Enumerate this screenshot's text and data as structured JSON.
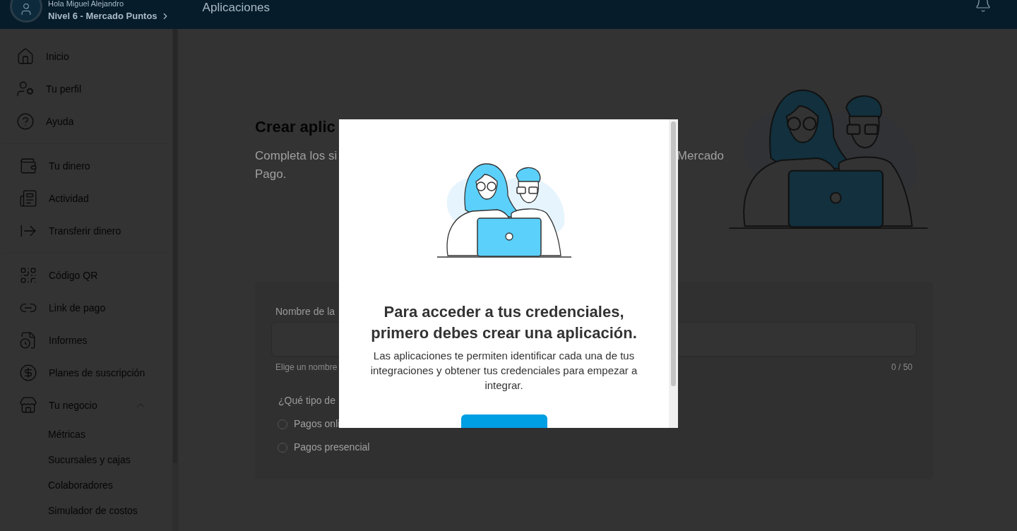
{
  "header": {
    "greeting": "Hola Miguel Alejandro",
    "level": "Nivel 6 - Mercado Puntos",
    "title": "Aplicaciones"
  },
  "sidebar": {
    "groups": [
      [
        {
          "label": "Inicio"
        },
        {
          "label": "Tu perfil"
        },
        {
          "label": "Ayuda"
        }
      ],
      [
        {
          "label": "Tu dinero"
        },
        {
          "label": "Actividad"
        },
        {
          "label": "Transferir dinero"
        }
      ],
      [
        {
          "label": "Código QR"
        },
        {
          "label": "Link de pago"
        },
        {
          "label": "Informes"
        },
        {
          "label": "Planes de suscripción"
        },
        {
          "label": "Tu negocio",
          "expanded": true,
          "children": [
            {
              "label": "Métricas"
            },
            {
              "label": "Sucursales y cajas"
            },
            {
              "label": "Colaboradores"
            },
            {
              "label": "Simulador de costos"
            }
          ]
        }
      ]
    ]
  },
  "page": {
    "title": "Crear aplic",
    "intro": {
      "line_1_start": "Completa los si",
      "line_1_end": "Mercado",
      "line_2": "Pago."
    },
    "form": {
      "field_label": "Nombre de la",
      "helper": "Elige un nombre",
      "counter": "0 / 50",
      "question": "¿Qué tipo de",
      "options": [
        {
          "label": "Pagos onli",
          "selected": false
        },
        {
          "label": "Pagos presencial",
          "selected": false
        }
      ]
    }
  },
  "modal": {
    "title": "Para acceder a tus credenciales, primero debes crear una aplicación.",
    "text": "Las aplicaciones te permiten identificar cada una de tus integraciones y obtener tus credenciales para empezar a integrar."
  }
}
